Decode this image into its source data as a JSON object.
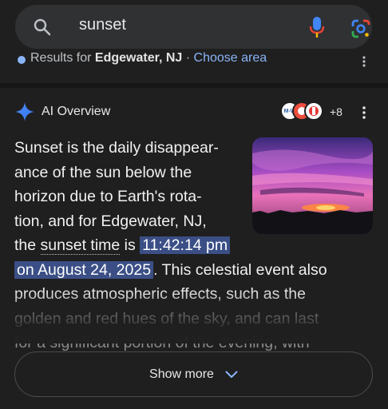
{
  "search": {
    "query": "sunset"
  },
  "location": {
    "prefix": "Results for ",
    "place": "Edgewater, NJ",
    "separator": " · ",
    "link": "Choose area"
  },
  "ai_overview": {
    "title": "AI Overview",
    "sources_more": "+8",
    "source_badge": "M-W",
    "lines": [
      "Sunset is the daily disappear-",
      "ance of the sun below the",
      "horizon due to Earth's rota-",
      "tion, and for Edgewater, NJ,"
    ],
    "line5_pre": "the ",
    "line5_term": "sunset time",
    "line5_mid": " is ",
    "line5_hl": "11:42:14 pm",
    "line6_hl": "on August 24, 2025",
    "line6_post": ". This celestial event also",
    "line7": "produces atmospheric effects, such as the",
    "line8": "golden and red hues of the sky, and can last",
    "line9": "for a significant portion of the evening, with"
  },
  "show_more": {
    "label": "Show more"
  },
  "colors": {
    "background": "#1f1f1f",
    "search_bar": "#2f3133",
    "highlight": "#3b4f86",
    "link": "#8ab4f8"
  },
  "icons": [
    "search-icon",
    "mic-icon",
    "google-lens-icon",
    "more-vert-icon",
    "ai-sparkle-icon",
    "chevron-down-icon"
  ]
}
